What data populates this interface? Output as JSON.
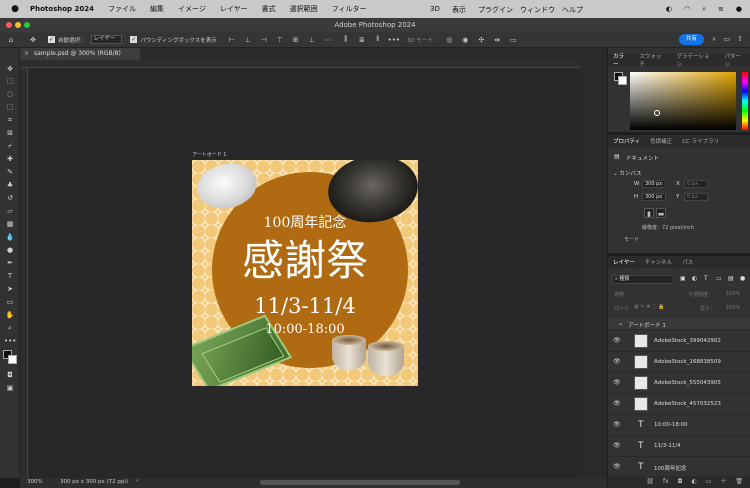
{
  "menubar": {
    "app": "Photoshop 2024",
    "items": [
      "ファイル",
      "編集",
      "イメージ",
      "レイヤー",
      "書式",
      "選択範囲",
      "フィルター"
    ],
    "right_items": [
      "3D",
      "表示",
      "プラグイン",
      "ウィンドウ",
      "ヘルプ"
    ]
  },
  "titlebar": {
    "title": "Adobe Photoshop 2024"
  },
  "options": {
    "auto_select_label": "自動選択：",
    "auto_select_value": "レイヤー",
    "bounding_box_label": "バウンディングボックスを表示",
    "mode_3d_label": "3D モード：",
    "share_label": "共有"
  },
  "document": {
    "tab_label": "sample.psd @ 300% (RGB/8)",
    "artboard_label": "アートボード 1",
    "zoom": "300%",
    "size_info": "300 px x 300 px (72 ppi)"
  },
  "artwork": {
    "line1": "100周年記念",
    "line2": "感謝祭",
    "line3": "11/3-11/4",
    "line4": "10:00-18:00",
    "colors": {
      "background": "#f2c879",
      "circle": "#b06a12",
      "pattern": "#fbe8c2"
    }
  },
  "color_panel": {
    "tabs": [
      "カラー",
      "スウォッチ",
      "グラデーション",
      "パターン"
    ]
  },
  "properties_panel": {
    "tabs": [
      "プロパティ",
      "色調補正",
      "CC ライブラリ"
    ],
    "doc_label": "ドキュメント",
    "canvas_label": "カンバス",
    "w_label": "W",
    "w_value": "300 px",
    "h_label": "H",
    "h_value": "300 px",
    "x_label": "X",
    "x_value": "0 px",
    "y_label": "Y",
    "y_value": "0 px",
    "resolution": "解像度：72 pixel/inch",
    "mode_label": "モード"
  },
  "layers_panel": {
    "tabs": [
      "レイヤー",
      "チャンネル",
      "パス"
    ],
    "filter_type": "種類",
    "blend_mode": "通常",
    "opacity_label": "不透明度：",
    "opacity_value": "100%",
    "lock_label": "ロック：",
    "fill_label": "塗り：",
    "fill_value": "100%",
    "group_name": "アートボード 1",
    "layers": [
      {
        "name": "AdobeStock_399042902",
        "kind": "image"
      },
      {
        "name": "AdobeStock_168838509",
        "kind": "image"
      },
      {
        "name": "AdobeStock_555043905",
        "kind": "image"
      },
      {
        "name": "AdobeStock_457032523",
        "kind": "image"
      },
      {
        "name": "10:00-18:00",
        "kind": "text"
      },
      {
        "name": "11/3-11/4",
        "kind": "text"
      },
      {
        "name": "100周年記念",
        "kind": "text"
      }
    ]
  }
}
